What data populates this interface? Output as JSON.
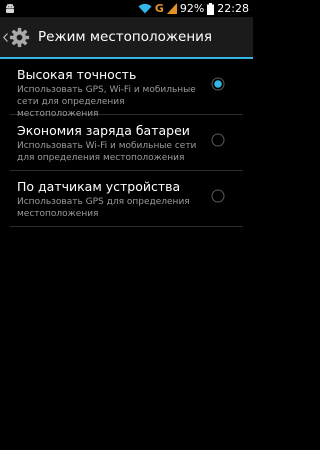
{
  "status_bar": {
    "network_type": "G",
    "battery_percent": "92%",
    "time": "22:28"
  },
  "action_bar": {
    "title": "Режим местоположения"
  },
  "options": [
    {
      "title": "Высокая точность",
      "summary": "Использовать GPS, Wi-Fi и мобильные сети для определения местоположения",
      "selected": true
    },
    {
      "title": "Экономия заряда батареи",
      "summary": "Использовать Wi-Fi и мобильные сети для определения местоположения",
      "selected": false
    },
    {
      "title": "По датчикам устройства",
      "summary": "Использовать GPS для определения местоположения",
      "selected": false
    }
  ],
  "colors": {
    "accent": "#33b5e5",
    "background": "#000000",
    "action_bar": "#1b1b1b",
    "summary_text": "#9b9b9b",
    "network_g": "#e39325"
  }
}
